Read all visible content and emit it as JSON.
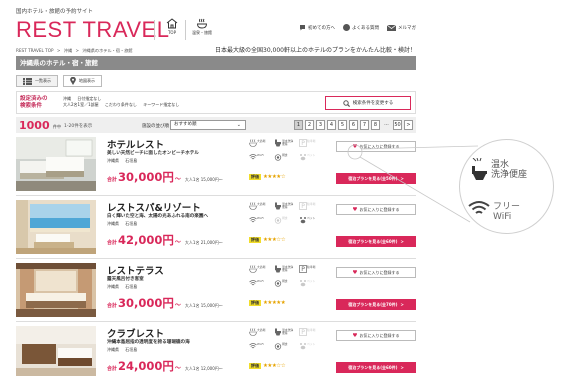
{
  "site": {
    "tagline": "国内ホテル・旅館の予約サイト",
    "logo": "REST TRAVEL",
    "nav": [
      {
        "icon": "building-icon",
        "label": "TOP"
      },
      {
        "icon": "hot-spring-icon",
        "label": "温泉・旅館"
      }
    ],
    "top_links": [
      {
        "icon": "help-icon",
        "label": "初めての方へ"
      },
      {
        "icon": "faq-icon",
        "label": "よくある質問"
      },
      {
        "icon": "mail-icon",
        "label": "メルマガ"
      }
    ]
  },
  "breadcrumb": [
    "REST TRAVEL TOP",
    ">",
    "沖縄",
    ">",
    "沖縄県のホテル・宿・旅館"
  ],
  "promo": "日本最大級の全国30,000軒以上のホテルのプランをかんたん比較・検討！",
  "region_title": "沖縄県のホテル・宿・旅館",
  "view_toggle": {
    "list": "一覧表示",
    "map": "地図表示"
  },
  "conditions": {
    "title_line1": "設定済みの",
    "title_line2": "検索条件",
    "line1": [
      "沖縄",
      "日付指定なし"
    ],
    "line2": [
      "大人2名1室／1部屋",
      "こだわり条件なし",
      "キーワード指定なし"
    ],
    "change_button": "検索条件を変更する"
  },
  "results": {
    "count": "1000",
    "unit": "件中",
    "range": "1-20件を表示",
    "sort_label": "施設の並び順",
    "sort_value": "おすすめ順",
    "pages": [
      "1",
      "2",
      "3",
      "4",
      "5",
      "6",
      "7",
      "8",
      "...",
      "50",
      ">"
    ],
    "current_page": "1"
  },
  "amenity_labels": {
    "bath": "大浴場",
    "toilet": "温水洗浄便座",
    "parking": "駐車場",
    "wifi": "Wi-Fi",
    "breakfast": "朝食",
    "pet": "ペット"
  },
  "hotels": [
    {
      "name": "ホテルレスト",
      "catch": "美しい天然ビーチに面したオンビーチホテル",
      "location": [
        "沖縄県",
        "石垣島"
      ],
      "price_prefix": "合計",
      "price": "30,000円",
      "tilde": "〜",
      "per_person": "大人1名 15,000円〜",
      "rating_label": "評価",
      "stars": "★★★★☆",
      "fav": "お気に入りに登録する",
      "plan": "宿泊プランを見る(全50件)",
      "plan_arrow": ">"
    },
    {
      "name": "レストスパ&リゾート",
      "catch": "白く輝いた空と海、太陽の光あふれる南の楽園へ",
      "location": [
        "沖縄県",
        "石垣島"
      ],
      "price_prefix": "合計",
      "price": "42,000円",
      "tilde": "〜",
      "per_person": "大人1名 21,000円〜",
      "rating_label": "評価",
      "stars": "★★★☆☆",
      "fav": "お気に入りに登録する",
      "plan": "宿泊プランを見る(全60件)",
      "plan_arrow": ">"
    },
    {
      "name": "レストテラス",
      "catch": "露天風呂付き客室",
      "location": [
        "沖縄県",
        "石垣島"
      ],
      "price_prefix": "合計",
      "price": "30,000円",
      "tilde": "〜",
      "per_person": "大人1名 15,000円〜",
      "rating_label": "評価",
      "stars": "★★★★★",
      "fav": "お気に入りに登録する",
      "plan": "宿泊プランを見る(全70件)",
      "plan_arrow": ">"
    },
    {
      "name": "クラブレスト",
      "catch": "沖縄本島屈指の透明度を誇る珊瑚礁の海",
      "location": [
        "沖縄県",
        "石垣島"
      ],
      "price_prefix": "合計",
      "price": "24,000円",
      "tilde": "〜",
      "per_person": "大人1名 12,000円〜",
      "rating_label": "評価",
      "stars": "★★★☆☆",
      "fav": "お気に入りに登録する",
      "plan": "宿泊プランを見る(全60件)",
      "plan_arrow": ">"
    }
  ],
  "callout": {
    "toilet_line1": "温水",
    "toilet_line2": "洗浄便座",
    "wifi_line1": "フリー",
    "wifi_line2": "WiFi"
  },
  "colors": {
    "brand": "#d9285a",
    "region_bar": "#8a8a8a",
    "badge": "#f1dd2a"
  }
}
